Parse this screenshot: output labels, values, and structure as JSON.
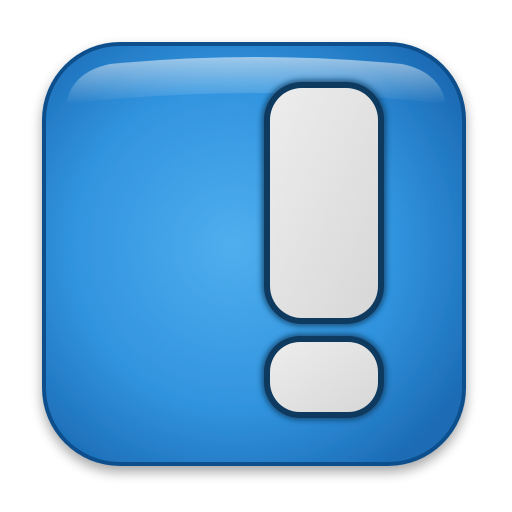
{
  "icon": {
    "name": "exclamation-app-icon",
    "glyph": "exclamation-mark"
  },
  "colors": {
    "background": "#ffffff",
    "tile_light": "#4aaef0",
    "tile_mid": "#2c92e0",
    "tile_dark": "#1568b4",
    "tile_edge": "#0d4f8c",
    "mark_fill": "#d8d8d8",
    "mark_highlight": "#efefef",
    "mark_outline": "#0e3a60"
  }
}
